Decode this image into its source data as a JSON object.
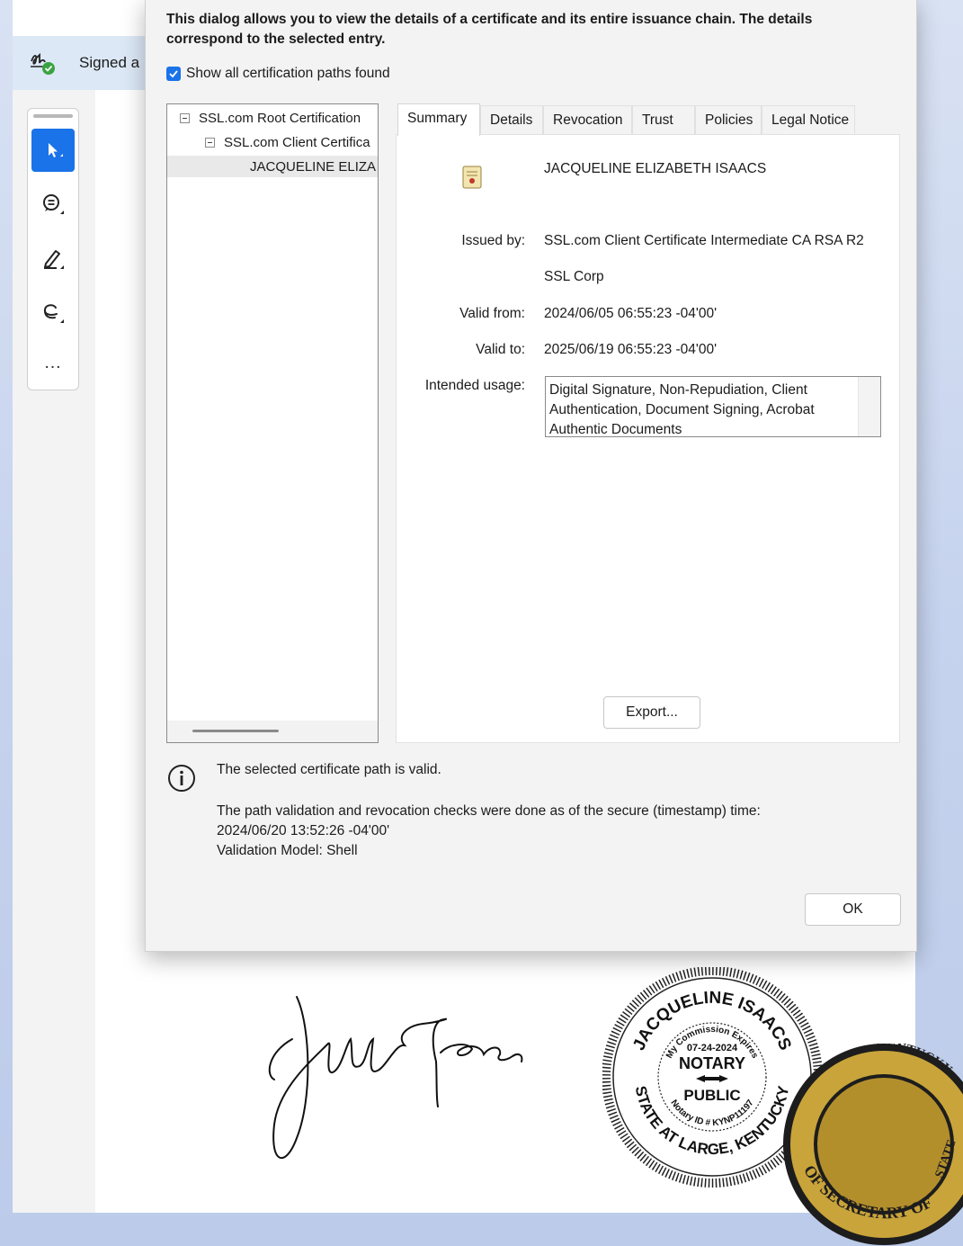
{
  "app": {
    "signature_banner": "Signed a",
    "toolbar": {
      "tools": [
        {
          "icon": "cursor-icon",
          "active": true
        },
        {
          "icon": "comment-icon",
          "active": false
        },
        {
          "icon": "highlight-pen-icon",
          "active": false
        },
        {
          "icon": "lasso-draw-icon",
          "active": false
        }
      ],
      "more_label": "…"
    }
  },
  "dialog": {
    "intro": "This dialog allows you to view the details of a certificate and its entire issuance chain. The details correspond to the selected entry.",
    "show_all_paths": {
      "label": "Show all certification paths found",
      "checked": true
    },
    "chain": [
      {
        "label": "SSL.com Root Certification",
        "level": 0,
        "expanded": true
      },
      {
        "label": "SSL.com Client Certifica",
        "level": 1,
        "expanded": true
      },
      {
        "label": "JACQUELINE ELIZA",
        "level": 2,
        "selected": true
      }
    ],
    "tabs": [
      "Summary",
      "Details",
      "Revocation",
      "Trust",
      "Policies",
      "Legal Notice"
    ],
    "active_tab": "Summary",
    "summary": {
      "subject": "JACQUELINE ELIZABETH ISAACS",
      "issued_by_label": "Issued by:",
      "issued_by": "SSL.com Client Certificate Intermediate CA RSA R2",
      "issuer_org": "SSL Corp",
      "valid_from_label": "Valid from:",
      "valid_from": "2024/06/05 06:55:23 -04'00'",
      "valid_to_label": "Valid to:",
      "valid_to": "2025/06/19 06:55:23 -04'00'",
      "usage_label": "Intended usage:",
      "usage": "Digital Signature, Non-Repudiation, Client Authentication, Document Signing, Acrobat Authentic Documents"
    },
    "export_label": "Export...",
    "status": "The selected certificate path is valid.",
    "details_line1": "The path validation and revocation checks were done as of the secure (timestamp) time:",
    "details_line2": "2024/06/20 13:52:26 -04'00'",
    "details_line3": "Validation Model: Shell",
    "ok_label": "OK"
  },
  "document": {
    "seal": {
      "name": "JACQUELINE ISAACS",
      "commission": "My Commission Expires",
      "date": "07-24-2024",
      "notary": "NOTARY",
      "public": "PUBLIC",
      "id": "Notary ID # KYNP11197",
      "state": "STATE AT LARGE, KENTUCKY"
    },
    "ky_seal_text": [
      "KENTUCKY",
      "STATE",
      "OF SECRETARY OF"
    ]
  },
  "colors": {
    "accent": "#1a73e8",
    "valid_green": "#3aa341"
  }
}
